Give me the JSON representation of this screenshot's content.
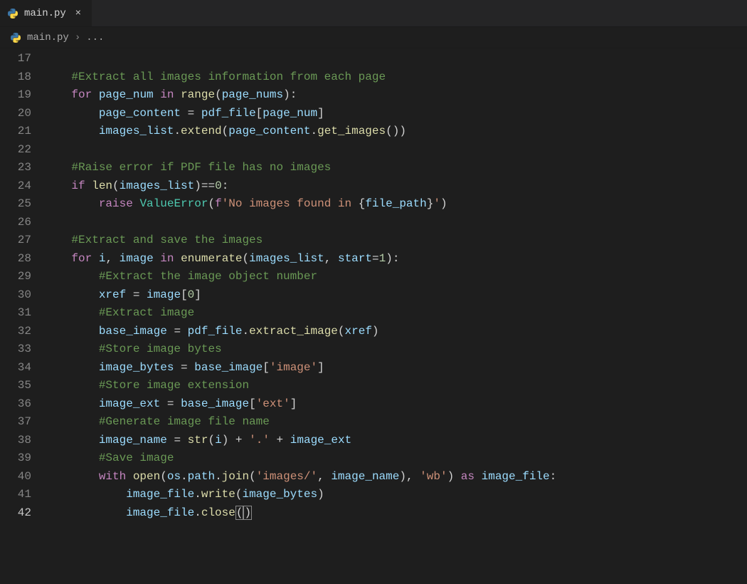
{
  "tab": {
    "file_name": "main.py",
    "close_glyph": "×"
  },
  "breadcrumb": {
    "file_name": "main.py",
    "separator": "›",
    "ellipsis": "..."
  },
  "icons": {
    "python": "python-icon"
  },
  "line_numbers": [
    17,
    18,
    19,
    20,
    21,
    22,
    23,
    24,
    25,
    26,
    27,
    28,
    29,
    30,
    31,
    32,
    33,
    34,
    35,
    36,
    37,
    38,
    39,
    40,
    41,
    42
  ],
  "current_line": 42,
  "code_lines": [
    {
      "n": 17,
      "indent": 0,
      "tokens": []
    },
    {
      "n": 18,
      "indent": 1,
      "tokens": [
        [
          "com",
          "#Extract all images information from each page"
        ]
      ]
    },
    {
      "n": 19,
      "indent": 1,
      "tokens": [
        [
          "kw",
          "for"
        ],
        [
          "sp",
          " "
        ],
        [
          "var",
          "page_num"
        ],
        [
          "sp",
          " "
        ],
        [
          "kw",
          "in"
        ],
        [
          "sp",
          " "
        ],
        [
          "fn",
          "range"
        ],
        [
          "pun",
          "("
        ],
        [
          "var",
          "page_nums"
        ],
        [
          "pun",
          ")"
        ],
        [
          "pun",
          ":"
        ]
      ]
    },
    {
      "n": 20,
      "indent": 2,
      "tokens": [
        [
          "var",
          "page_content"
        ],
        [
          "sp",
          " "
        ],
        [
          "op",
          "="
        ],
        [
          "sp",
          " "
        ],
        [
          "var",
          "pdf_file"
        ],
        [
          "pun",
          "["
        ],
        [
          "var",
          "page_num"
        ],
        [
          "pun",
          "]"
        ]
      ]
    },
    {
      "n": 21,
      "indent": 2,
      "tokens": [
        [
          "var",
          "images_list"
        ],
        [
          "pun",
          "."
        ],
        [
          "fn",
          "extend"
        ],
        [
          "pun",
          "("
        ],
        [
          "var",
          "page_content"
        ],
        [
          "pun",
          "."
        ],
        [
          "fn",
          "get_images"
        ],
        [
          "pun",
          "("
        ],
        [
          "pun",
          ")"
        ],
        [
          "pun",
          ")"
        ]
      ]
    },
    {
      "n": 22,
      "indent": 0,
      "tokens": []
    },
    {
      "n": 23,
      "indent": 1,
      "tokens": [
        [
          "com",
          "#Raise error if PDF file has no images"
        ]
      ]
    },
    {
      "n": 24,
      "indent": 1,
      "tokens": [
        [
          "kw",
          "if"
        ],
        [
          "sp",
          " "
        ],
        [
          "fn",
          "len"
        ],
        [
          "pun",
          "("
        ],
        [
          "var",
          "images_list"
        ],
        [
          "pun",
          ")"
        ],
        [
          "op",
          "=="
        ],
        [
          "num",
          "0"
        ],
        [
          "pun",
          ":"
        ]
      ]
    },
    {
      "n": 25,
      "indent": 2,
      "tokens": [
        [
          "kw",
          "raise"
        ],
        [
          "sp",
          " "
        ],
        [
          "cls",
          "ValueError"
        ],
        [
          "pun",
          "("
        ],
        [
          "kw",
          "f"
        ],
        [
          "str",
          "'No images found in "
        ],
        [
          "pun",
          "{"
        ],
        [
          "var",
          "file_path"
        ],
        [
          "pun",
          "}"
        ],
        [
          "str",
          "'"
        ],
        [
          "pun",
          ")"
        ]
      ]
    },
    {
      "n": 26,
      "indent": 0,
      "tokens": []
    },
    {
      "n": 27,
      "indent": 1,
      "tokens": [
        [
          "com",
          "#Extract and save the images"
        ]
      ]
    },
    {
      "n": 28,
      "indent": 1,
      "tokens": [
        [
          "kw",
          "for"
        ],
        [
          "sp",
          " "
        ],
        [
          "var",
          "i"
        ],
        [
          "pun",
          ","
        ],
        [
          "sp",
          " "
        ],
        [
          "var",
          "image"
        ],
        [
          "sp",
          " "
        ],
        [
          "kw",
          "in"
        ],
        [
          "sp",
          " "
        ],
        [
          "fn",
          "enumerate"
        ],
        [
          "pun",
          "("
        ],
        [
          "var",
          "images_list"
        ],
        [
          "pun",
          ","
        ],
        [
          "sp",
          " "
        ],
        [
          "var",
          "start"
        ],
        [
          "op",
          "="
        ],
        [
          "num",
          "1"
        ],
        [
          "pun",
          ")"
        ],
        [
          "pun",
          ":"
        ]
      ]
    },
    {
      "n": 29,
      "indent": 2,
      "tokens": [
        [
          "com",
          "#Extract the image object number"
        ]
      ]
    },
    {
      "n": 30,
      "indent": 2,
      "tokens": [
        [
          "var",
          "xref"
        ],
        [
          "sp",
          " "
        ],
        [
          "op",
          "="
        ],
        [
          "sp",
          " "
        ],
        [
          "var",
          "image"
        ],
        [
          "pun",
          "["
        ],
        [
          "num",
          "0"
        ],
        [
          "pun",
          "]"
        ]
      ]
    },
    {
      "n": 31,
      "indent": 2,
      "tokens": [
        [
          "com",
          "#Extract image"
        ]
      ]
    },
    {
      "n": 32,
      "indent": 2,
      "tokens": [
        [
          "var",
          "base_image"
        ],
        [
          "sp",
          " "
        ],
        [
          "op",
          "="
        ],
        [
          "sp",
          " "
        ],
        [
          "var",
          "pdf_file"
        ],
        [
          "pun",
          "."
        ],
        [
          "fn",
          "extract_image"
        ],
        [
          "pun",
          "("
        ],
        [
          "var",
          "xref"
        ],
        [
          "pun",
          ")"
        ]
      ]
    },
    {
      "n": 33,
      "indent": 2,
      "tokens": [
        [
          "com",
          "#Store image bytes"
        ]
      ]
    },
    {
      "n": 34,
      "indent": 2,
      "tokens": [
        [
          "var",
          "image_bytes"
        ],
        [
          "sp",
          " "
        ],
        [
          "op",
          "="
        ],
        [
          "sp",
          " "
        ],
        [
          "var",
          "base_image"
        ],
        [
          "pun",
          "["
        ],
        [
          "str",
          "'image'"
        ],
        [
          "pun",
          "]"
        ]
      ]
    },
    {
      "n": 35,
      "indent": 2,
      "tokens": [
        [
          "com",
          "#Store image extension"
        ]
      ]
    },
    {
      "n": 36,
      "indent": 2,
      "tokens": [
        [
          "var",
          "image_ext"
        ],
        [
          "sp",
          " "
        ],
        [
          "op",
          "="
        ],
        [
          "sp",
          " "
        ],
        [
          "var",
          "base_image"
        ],
        [
          "pun",
          "["
        ],
        [
          "str",
          "'ext'"
        ],
        [
          "pun",
          "]"
        ]
      ]
    },
    {
      "n": 37,
      "indent": 2,
      "tokens": [
        [
          "com",
          "#Generate image file name"
        ]
      ]
    },
    {
      "n": 38,
      "indent": 2,
      "tokens": [
        [
          "var",
          "image_name"
        ],
        [
          "sp",
          " "
        ],
        [
          "op",
          "="
        ],
        [
          "sp",
          " "
        ],
        [
          "fn",
          "str"
        ],
        [
          "pun",
          "("
        ],
        [
          "var",
          "i"
        ],
        [
          "pun",
          ")"
        ],
        [
          "sp",
          " "
        ],
        [
          "op",
          "+"
        ],
        [
          "sp",
          " "
        ],
        [
          "str",
          "'.'"
        ],
        [
          "sp",
          " "
        ],
        [
          "op",
          "+"
        ],
        [
          "sp",
          " "
        ],
        [
          "var",
          "image_ext"
        ]
      ]
    },
    {
      "n": 39,
      "indent": 2,
      "tokens": [
        [
          "com",
          "#Save image"
        ]
      ]
    },
    {
      "n": 40,
      "indent": 2,
      "tokens": [
        [
          "kw",
          "with"
        ],
        [
          "sp",
          " "
        ],
        [
          "fn",
          "open"
        ],
        [
          "pun",
          "("
        ],
        [
          "var",
          "os"
        ],
        [
          "pun",
          "."
        ],
        [
          "var",
          "path"
        ],
        [
          "pun",
          "."
        ],
        [
          "fn",
          "join"
        ],
        [
          "pun",
          "("
        ],
        [
          "str",
          "'images/'"
        ],
        [
          "pun",
          ","
        ],
        [
          "sp",
          " "
        ],
        [
          "var",
          "image_name"
        ],
        [
          "pun",
          ")"
        ],
        [
          "pun",
          ","
        ],
        [
          "sp",
          " "
        ],
        [
          "str",
          "'wb'"
        ],
        [
          "pun",
          ")"
        ],
        [
          "sp",
          " "
        ],
        [
          "kw",
          "as"
        ],
        [
          "sp",
          " "
        ],
        [
          "var",
          "image_file"
        ],
        [
          "pun",
          ":"
        ]
      ]
    },
    {
      "n": 41,
      "indent": 3,
      "tokens": [
        [
          "var",
          "image_file"
        ],
        [
          "pun",
          "."
        ],
        [
          "fn",
          "write"
        ],
        [
          "pun",
          "("
        ],
        [
          "var",
          "image_bytes"
        ],
        [
          "pun",
          ")"
        ]
      ]
    },
    {
      "n": 42,
      "indent": 3,
      "tokens": [
        [
          "var",
          "image_file"
        ],
        [
          "pun",
          "."
        ],
        [
          "fn",
          "close"
        ],
        [
          "pun",
          "("
        ],
        [
          "pun",
          ")"
        ]
      ]
    }
  ]
}
